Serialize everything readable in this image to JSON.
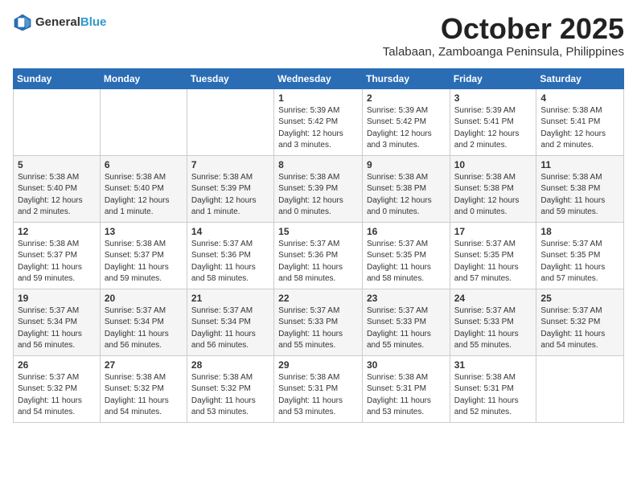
{
  "header": {
    "logo_general": "General",
    "logo_blue": "Blue",
    "month": "October 2025",
    "location": "Talabaan, Zamboanga Peninsula, Philippines"
  },
  "weekdays": [
    "Sunday",
    "Monday",
    "Tuesday",
    "Wednesday",
    "Thursday",
    "Friday",
    "Saturday"
  ],
  "weeks": [
    [
      {
        "day": "",
        "info": ""
      },
      {
        "day": "",
        "info": ""
      },
      {
        "day": "",
        "info": ""
      },
      {
        "day": "1",
        "info": "Sunrise: 5:39 AM\nSunset: 5:42 PM\nDaylight: 12 hours\nand 3 minutes."
      },
      {
        "day": "2",
        "info": "Sunrise: 5:39 AM\nSunset: 5:42 PM\nDaylight: 12 hours\nand 3 minutes."
      },
      {
        "day": "3",
        "info": "Sunrise: 5:39 AM\nSunset: 5:41 PM\nDaylight: 12 hours\nand 2 minutes."
      },
      {
        "day": "4",
        "info": "Sunrise: 5:38 AM\nSunset: 5:41 PM\nDaylight: 12 hours\nand 2 minutes."
      }
    ],
    [
      {
        "day": "5",
        "info": "Sunrise: 5:38 AM\nSunset: 5:40 PM\nDaylight: 12 hours\nand 2 minutes."
      },
      {
        "day": "6",
        "info": "Sunrise: 5:38 AM\nSunset: 5:40 PM\nDaylight: 12 hours\nand 1 minute."
      },
      {
        "day": "7",
        "info": "Sunrise: 5:38 AM\nSunset: 5:39 PM\nDaylight: 12 hours\nand 1 minute."
      },
      {
        "day": "8",
        "info": "Sunrise: 5:38 AM\nSunset: 5:39 PM\nDaylight: 12 hours\nand 0 minutes."
      },
      {
        "day": "9",
        "info": "Sunrise: 5:38 AM\nSunset: 5:38 PM\nDaylight: 12 hours\nand 0 minutes."
      },
      {
        "day": "10",
        "info": "Sunrise: 5:38 AM\nSunset: 5:38 PM\nDaylight: 12 hours\nand 0 minutes."
      },
      {
        "day": "11",
        "info": "Sunrise: 5:38 AM\nSunset: 5:38 PM\nDaylight: 11 hours\nand 59 minutes."
      }
    ],
    [
      {
        "day": "12",
        "info": "Sunrise: 5:38 AM\nSunset: 5:37 PM\nDaylight: 11 hours\nand 59 minutes."
      },
      {
        "day": "13",
        "info": "Sunrise: 5:38 AM\nSunset: 5:37 PM\nDaylight: 11 hours\nand 59 minutes."
      },
      {
        "day": "14",
        "info": "Sunrise: 5:37 AM\nSunset: 5:36 PM\nDaylight: 11 hours\nand 58 minutes."
      },
      {
        "day": "15",
        "info": "Sunrise: 5:37 AM\nSunset: 5:36 PM\nDaylight: 11 hours\nand 58 minutes."
      },
      {
        "day": "16",
        "info": "Sunrise: 5:37 AM\nSunset: 5:35 PM\nDaylight: 11 hours\nand 58 minutes."
      },
      {
        "day": "17",
        "info": "Sunrise: 5:37 AM\nSunset: 5:35 PM\nDaylight: 11 hours\nand 57 minutes."
      },
      {
        "day": "18",
        "info": "Sunrise: 5:37 AM\nSunset: 5:35 PM\nDaylight: 11 hours\nand 57 minutes."
      }
    ],
    [
      {
        "day": "19",
        "info": "Sunrise: 5:37 AM\nSunset: 5:34 PM\nDaylight: 11 hours\nand 56 minutes."
      },
      {
        "day": "20",
        "info": "Sunrise: 5:37 AM\nSunset: 5:34 PM\nDaylight: 11 hours\nand 56 minutes."
      },
      {
        "day": "21",
        "info": "Sunrise: 5:37 AM\nSunset: 5:34 PM\nDaylight: 11 hours\nand 56 minutes."
      },
      {
        "day": "22",
        "info": "Sunrise: 5:37 AM\nSunset: 5:33 PM\nDaylight: 11 hours\nand 55 minutes."
      },
      {
        "day": "23",
        "info": "Sunrise: 5:37 AM\nSunset: 5:33 PM\nDaylight: 11 hours\nand 55 minutes."
      },
      {
        "day": "24",
        "info": "Sunrise: 5:37 AM\nSunset: 5:33 PM\nDaylight: 11 hours\nand 55 minutes."
      },
      {
        "day": "25",
        "info": "Sunrise: 5:37 AM\nSunset: 5:32 PM\nDaylight: 11 hours\nand 54 minutes."
      }
    ],
    [
      {
        "day": "26",
        "info": "Sunrise: 5:37 AM\nSunset: 5:32 PM\nDaylight: 11 hours\nand 54 minutes."
      },
      {
        "day": "27",
        "info": "Sunrise: 5:38 AM\nSunset: 5:32 PM\nDaylight: 11 hours\nand 54 minutes."
      },
      {
        "day": "28",
        "info": "Sunrise: 5:38 AM\nSunset: 5:32 PM\nDaylight: 11 hours\nand 53 minutes."
      },
      {
        "day": "29",
        "info": "Sunrise: 5:38 AM\nSunset: 5:31 PM\nDaylight: 11 hours\nand 53 minutes."
      },
      {
        "day": "30",
        "info": "Sunrise: 5:38 AM\nSunset: 5:31 PM\nDaylight: 11 hours\nand 53 minutes."
      },
      {
        "day": "31",
        "info": "Sunrise: 5:38 AM\nSunset: 5:31 PM\nDaylight: 11 hours\nand 52 minutes."
      },
      {
        "day": "",
        "info": ""
      }
    ]
  ]
}
